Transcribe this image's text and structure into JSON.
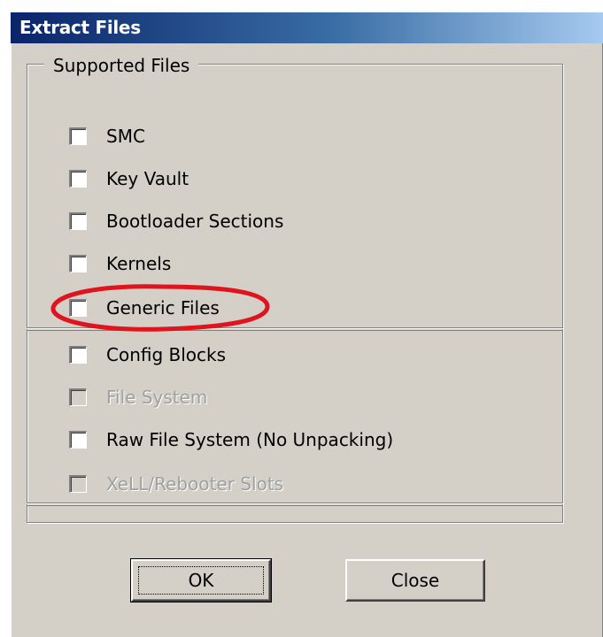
{
  "window": {
    "title": "Extract Files"
  },
  "group": {
    "title": "Supported Files"
  },
  "checkboxes": [
    {
      "label": "SMC",
      "checked": false,
      "enabled": true
    },
    {
      "label": "Key Vault",
      "checked": false,
      "enabled": true
    },
    {
      "label": "Bootloader Sections",
      "checked": false,
      "enabled": true
    },
    {
      "label": "Kernels",
      "checked": false,
      "enabled": true
    },
    {
      "label": "Generic Files",
      "checked": false,
      "enabled": true
    },
    {
      "label": "Config Blocks",
      "checked": false,
      "enabled": true
    },
    {
      "label": "File System",
      "checked": false,
      "enabled": false
    },
    {
      "label": "Raw File System (No Unpacking)",
      "checked": false,
      "enabled": true
    },
    {
      "label": "XeLL/Rebooter Slots",
      "checked": false,
      "enabled": false
    }
  ],
  "buttons": {
    "ok": "OK",
    "close": "Close"
  },
  "annotation": {
    "color": "#e0141e",
    "target": "Generic Files"
  },
  "colors": {
    "face": "#d4d0c8",
    "title_start": "#0a246a",
    "title_end": "#a6caf0"
  }
}
